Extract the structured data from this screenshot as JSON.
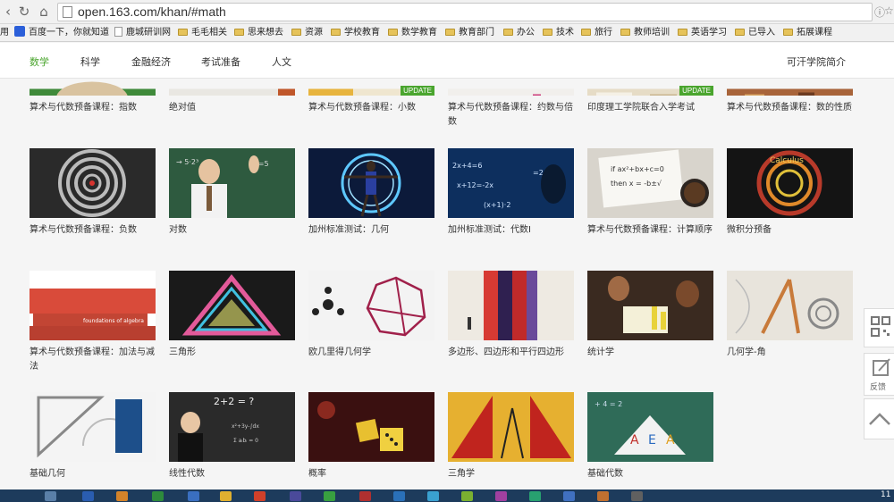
{
  "browser": {
    "url": "open.163.com/khan/#math"
  },
  "bookmarks": [
    {
      "label": "用",
      "kind": "none"
    },
    {
      "label": "百度一下，你就知道",
      "kind": "baidu"
    },
    {
      "label": "鹿城研训网",
      "kind": "page"
    },
    {
      "label": "毛毛相关",
      "kind": "folder"
    },
    {
      "label": "思来想去",
      "kind": "folder"
    },
    {
      "label": "资源",
      "kind": "folder"
    },
    {
      "label": "学校教育",
      "kind": "folder"
    },
    {
      "label": "数学教育",
      "kind": "folder"
    },
    {
      "label": "教育部门",
      "kind": "folder"
    },
    {
      "label": "办公",
      "kind": "folder"
    },
    {
      "label": "技术",
      "kind": "folder"
    },
    {
      "label": "旅行",
      "kind": "folder"
    },
    {
      "label": "教师培训",
      "kind": "folder"
    },
    {
      "label": "英语学习",
      "kind": "folder"
    },
    {
      "label": "已导入",
      "kind": "folder"
    },
    {
      "label": "拓展课程",
      "kind": "folder"
    }
  ],
  "nav": {
    "items": [
      "数学",
      "科学",
      "金融经济",
      "考试准备",
      "人文"
    ],
    "active": "数学",
    "about": "可汗学院简介"
  },
  "update_label": "UPDATE",
  "courses": [
    {
      "title": "算术与代数预备课程：指数",
      "update": false
    },
    {
      "title": "绝对值",
      "update": false
    },
    {
      "title": "算术与代数预备课程：小数",
      "update": true
    },
    {
      "title": "算术与代数预备课程：约数与倍数",
      "update": false
    },
    {
      "title": "印度理工学院联合入学考试",
      "update": true
    },
    {
      "title": "算术与代数预备课程：数的性质",
      "update": false
    },
    {
      "title": "算术与代数预备课程：负数",
      "update": false
    },
    {
      "title": "对数",
      "update": false
    },
    {
      "title": "加州标准测试：几何",
      "update": false
    },
    {
      "title": "加州标准测试：代数I",
      "update": false
    },
    {
      "title": "算术与代数预备课程：计算顺序",
      "update": false
    },
    {
      "title": "微积分预备",
      "update": false
    },
    {
      "title": "算术与代数预备课程：加法与减法",
      "update": false
    },
    {
      "title": "三角形",
      "update": false
    },
    {
      "title": "欧几里得几何学",
      "update": false
    },
    {
      "title": "多边形、四边形和平行四边形",
      "update": false
    },
    {
      "title": "统计学",
      "update": false
    },
    {
      "title": "几何学-角",
      "update": false
    },
    {
      "title": "基础几何",
      "update": false
    },
    {
      "title": "线性代数",
      "update": false
    },
    {
      "title": "概率",
      "update": false
    },
    {
      "title": "三角学",
      "update": false
    },
    {
      "title": "基础代数",
      "update": false
    }
  ],
  "side": {
    "feedback": "反馈"
  },
  "taskbar": {
    "time": "11"
  }
}
